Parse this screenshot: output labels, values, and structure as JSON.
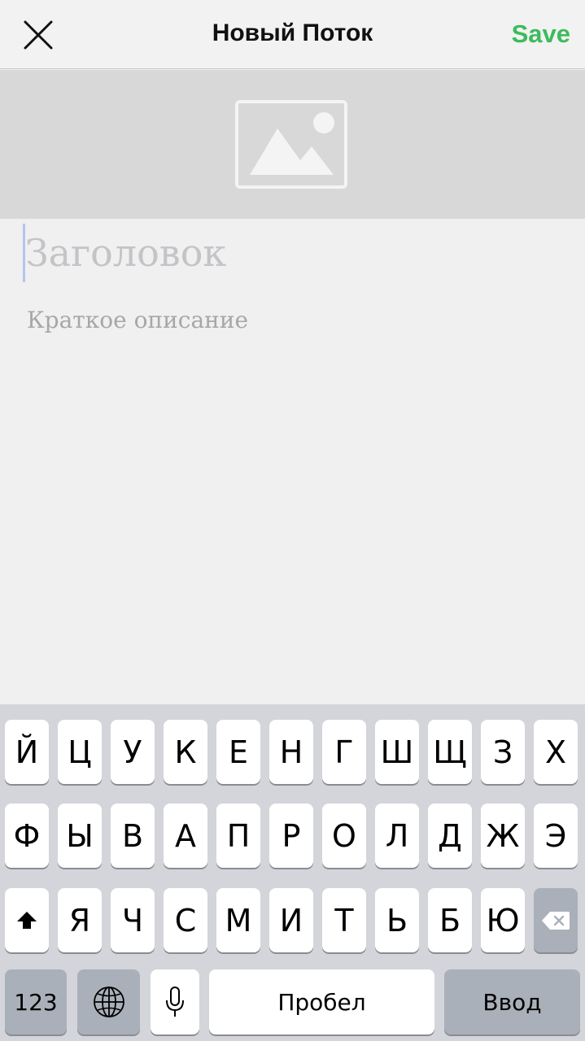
{
  "header": {
    "close_icon": "close-icon",
    "title": "Новый Поток",
    "save_label": "Save",
    "accent_color": "#3dbb5c"
  },
  "cover": {
    "icon": "image-placeholder-icon"
  },
  "form": {
    "title_placeholder": "Заголовок",
    "description_placeholder": "Краткое описание"
  },
  "keyboard": {
    "row1": [
      "Й",
      "Ц",
      "У",
      "К",
      "Е",
      "Н",
      "Г",
      "Ш",
      "Щ",
      "З",
      "Х"
    ],
    "row2": [
      "Ф",
      "Ы",
      "В",
      "А",
      "П",
      "Р",
      "О",
      "Л",
      "Д",
      "Ж",
      "Э"
    ],
    "row3": [
      "Я",
      "Ч",
      "С",
      "М",
      "И",
      "Т",
      "Ь",
      "Б",
      "Ю"
    ],
    "shift_icon": "shift-icon",
    "backspace_icon": "backspace-icon",
    "numbers_label": "123",
    "globe_icon": "globe-icon",
    "mic_icon": "microphone-icon",
    "space_label": "Пробел",
    "return_label": "Ввод"
  }
}
